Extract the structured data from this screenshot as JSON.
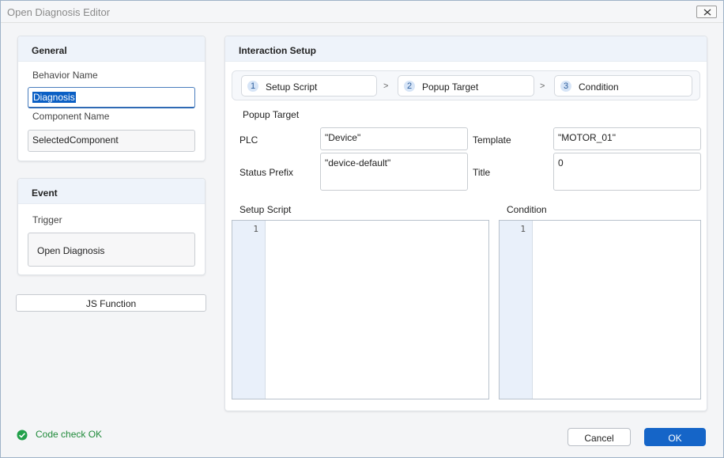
{
  "window": {
    "title": "Open Diagnosis Editor"
  },
  "general": {
    "header": "General",
    "behavior_name_label": "Behavior Name",
    "behavior_name_value": "Diagnosis",
    "component_name_label": "Component Name",
    "component_name_value": "SelectedComponent"
  },
  "event": {
    "header": "Event",
    "trigger_label": "Trigger",
    "trigger_value": "Open Diagnosis"
  },
  "js_function_label": "JS Function",
  "interaction": {
    "header": "Interaction Setup",
    "steps": [
      {
        "num": "1",
        "label": "Setup Script"
      },
      {
        "num": "2",
        "label": "Popup Target"
      },
      {
        "num": "3",
        "label": "Condition"
      }
    ],
    "separator": ">",
    "popup_target_label": "Popup Target",
    "plc_label": "PLC",
    "plc_value": "\"Device\"",
    "template_label": "Template",
    "template_value": "\"MOTOR_01\"",
    "status_prefix_label": "Status Prefix",
    "status_prefix_value": "\"device-default\"",
    "title_label": "Title",
    "title_value": "0",
    "setup_script_label": "Setup Script",
    "setup_script_line": "1",
    "condition_label": "Condition",
    "condition_line": "1"
  },
  "status": {
    "text": "Code check OK",
    "color": "#1f8a3a"
  },
  "buttons": {
    "cancel": "Cancel",
    "ok": "OK"
  },
  "colors": {
    "accent": "#1565c8",
    "header_bg": "#eef3fa"
  }
}
